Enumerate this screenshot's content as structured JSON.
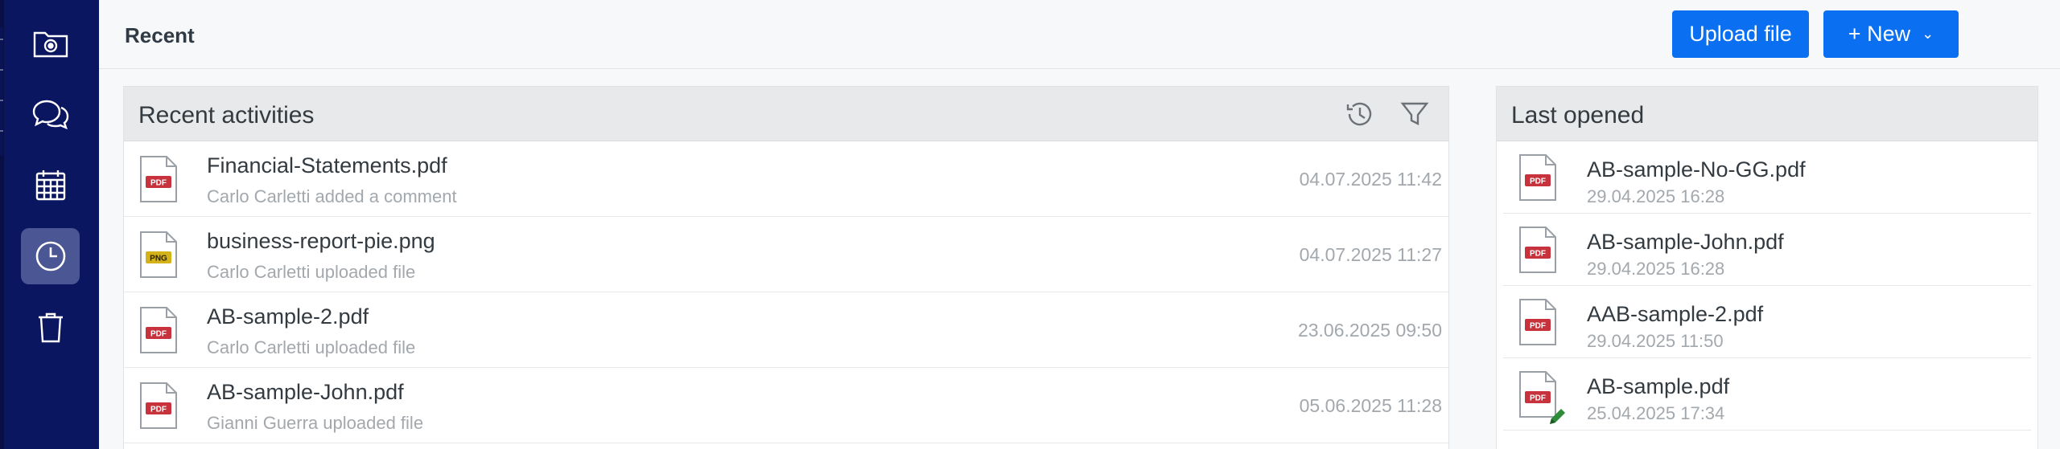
{
  "sidebar": {
    "items": [
      {
        "name": "files-icon"
      },
      {
        "name": "chat-icon"
      },
      {
        "name": "calendar-icon"
      },
      {
        "name": "recent-clock-icon",
        "active": true
      },
      {
        "name": "trash-icon"
      }
    ]
  },
  "header": {
    "title": "Recent",
    "upload_label": "Upload file",
    "new_label": "+ New",
    "new_chevron": "⌄"
  },
  "activities": {
    "title": "Recent activities",
    "items": [
      {
        "type": "PDF",
        "name": "Financial-Statements.pdf",
        "desc": "Carlo Carletti added a comment",
        "date": "04.07.2025 11:42"
      },
      {
        "type": "PNG",
        "name": "business-report-pie.png",
        "desc": "Carlo Carletti uploaded file",
        "date": "04.07.2025 11:27"
      },
      {
        "type": "PDF",
        "name": "AB-sample-2.pdf",
        "desc": "Carlo Carletti uploaded file",
        "date": "23.06.2025 09:50"
      },
      {
        "type": "PDF",
        "name": "AB-sample-John.pdf",
        "desc": "Gianni Guerra uploaded file",
        "date": "05.06.2025 11:28"
      }
    ]
  },
  "last_opened": {
    "title": "Last opened",
    "items": [
      {
        "type": "PDF",
        "name": "AB-sample-No-GG.pdf",
        "date": "29.04.2025 16:28"
      },
      {
        "type": "PDF",
        "name": "AB-sample-John.pdf",
        "date": "29.04.2025 16:28"
      },
      {
        "type": "PDF",
        "name": "AAB-sample-2.pdf",
        "date": "29.04.2025 11:50"
      },
      {
        "type": "PDF",
        "name": "AB-sample.pdf",
        "date": "25.04.2025 17:34",
        "edited": true
      }
    ]
  },
  "colors": {
    "sidebar": "#0b1660",
    "accent": "#0a6ff0",
    "pdf_badge": "#c8323c",
    "png_badge": "#d4b21a",
    "pencil": "#2e8b3a"
  }
}
